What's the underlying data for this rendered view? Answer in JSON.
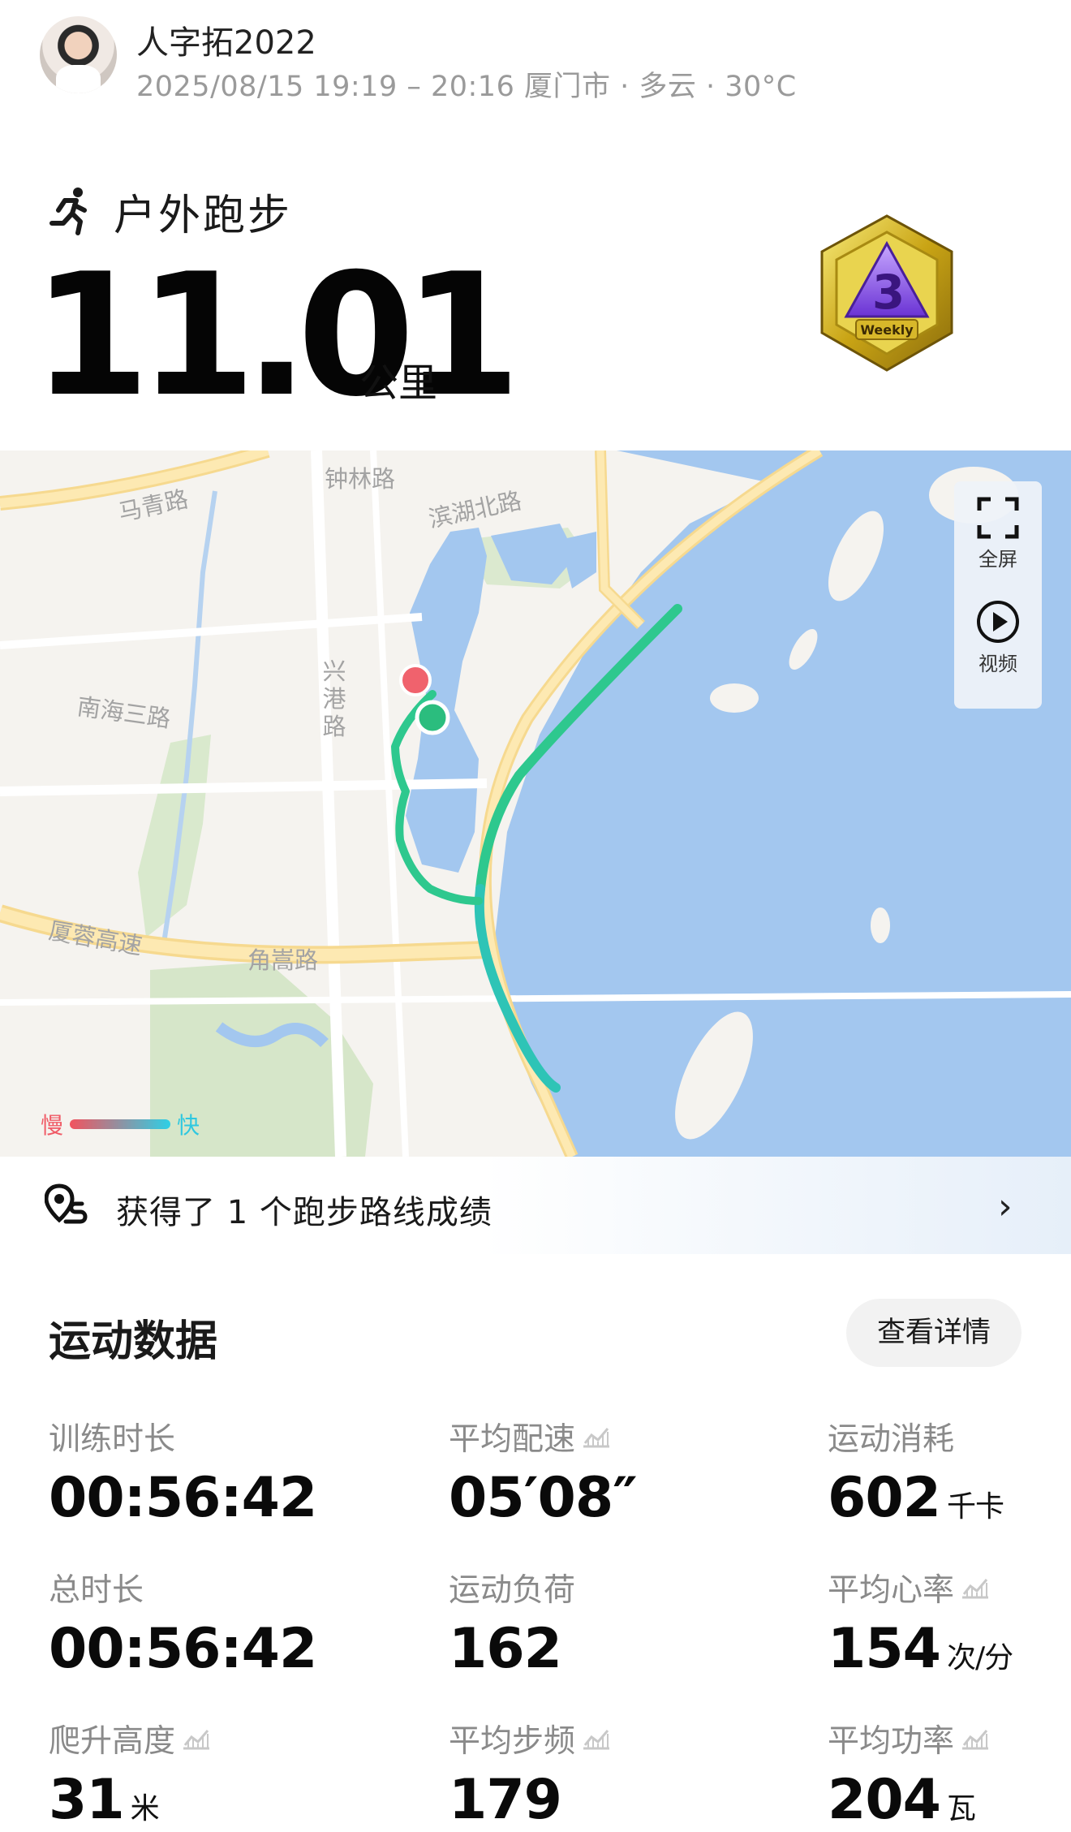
{
  "header": {
    "username": "人字拓2022",
    "subline": "2025/08/15 19:19 – 20:16 厦门市 · 多云 · 30°C"
  },
  "activity": {
    "type_label": "户外跑步",
    "distance": "11.01",
    "distance_unit": "公里",
    "medal_text": "Weekly",
    "medal_number": "3"
  },
  "map": {
    "road_labels": {
      "zhonglin": "钟林路",
      "maqing": "马青路",
      "binhu": "滨湖北路",
      "xinggang": "兴港路",
      "nanhai": "南海三路",
      "xiarong": "厦蓉高速",
      "jiaosong": "角嵩路"
    },
    "controls": {
      "fullscreen": "全屏",
      "video": "视频"
    },
    "legend": {
      "slow": "慢",
      "fast": "快"
    },
    "colors": {
      "water": "#a3c7ef",
      "route": "#2ec88e",
      "start": "#f0626d",
      "end": "#2bbd7e"
    }
  },
  "banner": {
    "text": "获得了 1 个跑步路线成绩"
  },
  "stats": {
    "title": "运动数据",
    "detail_button": "查看详情",
    "items": [
      {
        "label": "训练时长",
        "value": "00:56:42",
        "unit": ""
      },
      {
        "label": "平均配速",
        "value": "05′08″",
        "unit": ""
      },
      {
        "label": "运动消耗",
        "value": "602",
        "unit": "千卡"
      },
      {
        "label": "总时长",
        "value": "00:56:42",
        "unit": ""
      },
      {
        "label": "运动负荷",
        "value": "162",
        "unit": ""
      },
      {
        "label": "平均心率",
        "value": "154",
        "unit": "次/分"
      },
      {
        "label": "爬升高度",
        "value": "31",
        "unit": "米"
      },
      {
        "label": "平均步频",
        "value": "179",
        "unit": ""
      },
      {
        "label": "平均功率",
        "value": "204",
        "unit": "瓦"
      }
    ]
  }
}
